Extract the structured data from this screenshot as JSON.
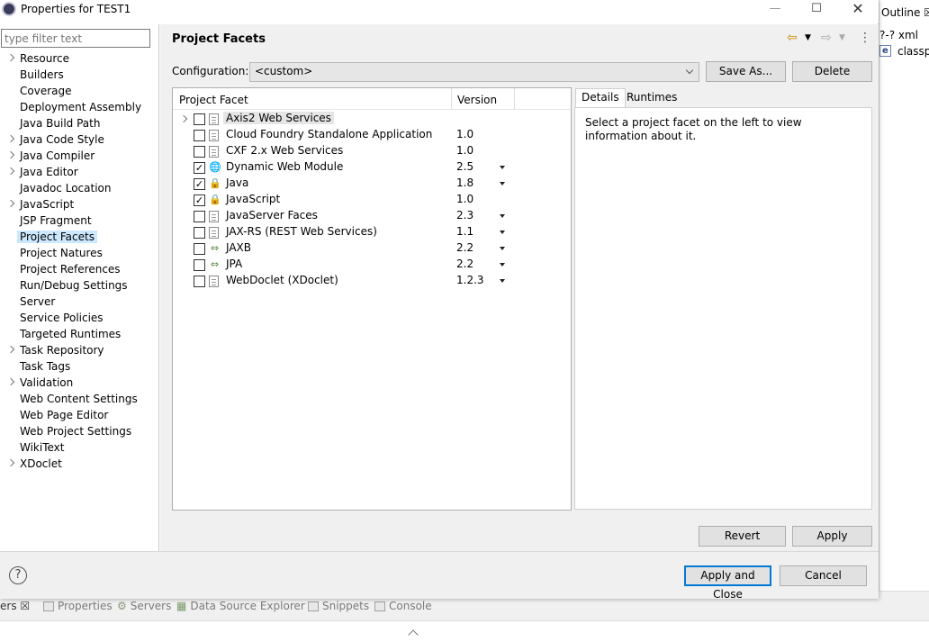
{
  "window": {
    "title": "Properties for TEST1",
    "minimize": "—",
    "maximize": "☐",
    "close": "✕"
  },
  "filter": {
    "placeholder": "type filter text"
  },
  "tree": {
    "items": [
      {
        "label": "Resource",
        "expandable": true
      },
      {
        "label": "Builders",
        "expandable": false
      },
      {
        "label": "Coverage",
        "expandable": false
      },
      {
        "label": "Deployment Assembly",
        "expandable": false
      },
      {
        "label": "Java Build Path",
        "expandable": false
      },
      {
        "label": "Java Code Style",
        "expandable": true
      },
      {
        "label": "Java Compiler",
        "expandable": true
      },
      {
        "label": "Java Editor",
        "expandable": true
      },
      {
        "label": "Javadoc Location",
        "expandable": false
      },
      {
        "label": "JavaScript",
        "expandable": true
      },
      {
        "label": "JSP Fragment",
        "expandable": false
      },
      {
        "label": "Project Facets",
        "expandable": false,
        "selected": true
      },
      {
        "label": "Project Natures",
        "expandable": false
      },
      {
        "label": "Project References",
        "expandable": false
      },
      {
        "label": "Run/Debug Settings",
        "expandable": false
      },
      {
        "label": "Server",
        "expandable": false
      },
      {
        "label": "Service Policies",
        "expandable": false
      },
      {
        "label": "Targeted Runtimes",
        "expandable": false
      },
      {
        "label": "Task Repository",
        "expandable": true
      },
      {
        "label": "Task Tags",
        "expandable": false
      },
      {
        "label": "Validation",
        "expandable": true
      },
      {
        "label": "Web Content Settings",
        "expandable": false
      },
      {
        "label": "Web Page Editor",
        "expandable": false
      },
      {
        "label": "Web Project Settings",
        "expandable": false
      },
      {
        "label": "WikiText",
        "expandable": false
      },
      {
        "label": "XDoclet",
        "expandable": true
      }
    ]
  },
  "page": {
    "title": "Project Facets"
  },
  "nav": {
    "back": "⇦",
    "forward": "⇨",
    "menu": "⋮"
  },
  "config": {
    "label": "Configuration:",
    "value": "<custom>",
    "save_as": "Save As...",
    "delete": "Delete"
  },
  "facets": {
    "col_facet": "Project Facet",
    "col_version": "Version",
    "rows": [
      {
        "name": "Axis2 Web Services",
        "version": "",
        "checked": false,
        "expandable": true,
        "highlight": true,
        "icon": "doc",
        "dropdown": false
      },
      {
        "name": "Cloud Foundry Standalone Application",
        "version": "1.0",
        "checked": false,
        "icon": "doc",
        "dropdown": false
      },
      {
        "name": "CXF 2.x Web Services",
        "version": "1.0",
        "checked": false,
        "icon": "doc",
        "dropdown": false
      },
      {
        "name": "Dynamic Web Module",
        "version": "2.5",
        "checked": true,
        "icon": "web",
        "dropdown": true
      },
      {
        "name": "Java",
        "version": "1.8",
        "checked": true,
        "icon": "lock",
        "dropdown": true
      },
      {
        "name": "JavaScript",
        "version": "1.0",
        "checked": true,
        "icon": "lock",
        "dropdown": false
      },
      {
        "name": "JavaServer Faces",
        "version": "2.3",
        "checked": false,
        "icon": "doc",
        "dropdown": true
      },
      {
        "name": "JAX-RS (REST Web Services)",
        "version": "1.1",
        "checked": false,
        "icon": "doc",
        "dropdown": true
      },
      {
        "name": "JAXB",
        "version": "2.2",
        "checked": false,
        "icon": "arrows",
        "dropdown": true
      },
      {
        "name": "JPA",
        "version": "2.2",
        "checked": false,
        "icon": "arrows",
        "dropdown": true
      },
      {
        "name": "WebDoclet (XDoclet)",
        "version": "1.2.3",
        "checked": false,
        "icon": "doc",
        "dropdown": true
      }
    ]
  },
  "details": {
    "tab_details": "Details",
    "tab_runtimes": "Runtimes",
    "message": "Select a project facet on the left to view information about it."
  },
  "buttons": {
    "revert": "Revert",
    "apply": "Apply",
    "apply_close": "Apply and Close",
    "cancel": "Cancel",
    "help": "?"
  },
  "background": {
    "outline_tab": "Outline ☒",
    "outline_row1": "?-? xml",
    "outline_row2": "classpa",
    "bottom_tabs": [
      "ers ☒",
      "Properties",
      "Servers",
      "Data Source Explorer",
      "Snippets",
      "Console"
    ]
  }
}
